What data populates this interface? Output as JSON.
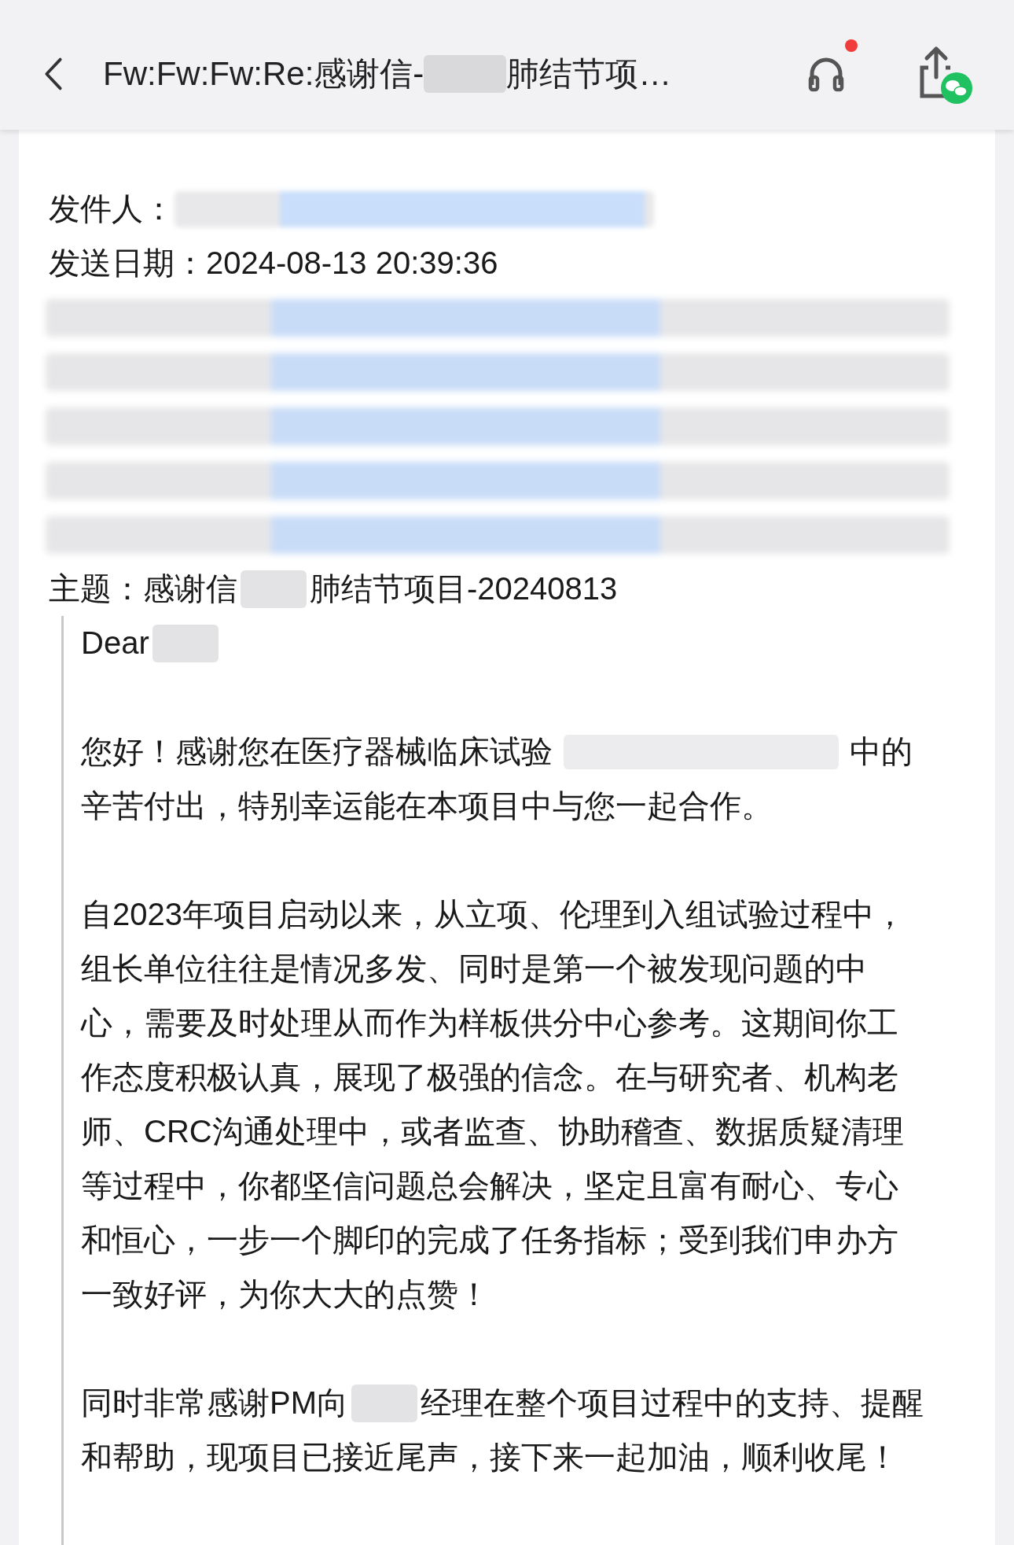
{
  "header": {
    "title_start": "Fw:Fw:Fw:Re:感谢信-",
    "title_end": "肺结节项…",
    "notification_dot": true
  },
  "meta": [
    {
      "kind": "sender",
      "label": "发件人："
    },
    {
      "kind": "field",
      "label": "发送日期：",
      "value": "2024-08-13 20:39:36"
    },
    {
      "kind": "hidden"
    },
    {
      "kind": "hidden"
    },
    {
      "kind": "hidden"
    },
    {
      "kind": "hidden"
    },
    {
      "kind": "hidden"
    }
  ],
  "subject": {
    "label": "主题：",
    "segments": [
      {
        "kind": "text",
        "text": "感谢信"
      },
      {
        "kind": "redacted"
      },
      {
        "kind": "text",
        "text": "肺结节项目-20240813"
      }
    ]
  },
  "body": [
    [
      [
        {
          "kind": "text",
          "text": "Dear"
        },
        {
          "kind": "redacted"
        }
      ]
    ],
    [
      [
        {
          "kind": "text",
          "text": "您好！感谢您在医疗器械临床试验"
        },
        {
          "kind": "redacted_long"
        },
        {
          "kind": "text",
          "text": "中的"
        }
      ],
      [
        {
          "kind": "text",
          "text": "辛苦付出，特别幸运能在本项目中与您一起合作。"
        }
      ]
    ],
    [
      [
        {
          "kind": "text",
          "text": "自2023年项目启动以来，从立项、伦理到入组试验过程中，"
        }
      ],
      [
        {
          "kind": "text",
          "text": "组长单位往往是情况多发、同时是第一个被发现问题的中"
        }
      ],
      [
        {
          "kind": "text",
          "text": "心，需要及时处理从而作为样板供分中心参考。这期间你工"
        }
      ],
      [
        {
          "kind": "text",
          "text": "作态度积极认真，展现了极强的信念。在与研究者、机构老"
        }
      ],
      [
        {
          "kind": "text",
          "text": "师、CRC沟通处理中，或者监查、协助稽查、数据质疑清理"
        }
      ],
      [
        {
          "kind": "text",
          "text": "等过程中，你都坚信问题总会解决，坚定且富有耐心、专心"
        }
      ],
      [
        {
          "kind": "text",
          "text": "和恒心，一步一个脚印的完成了任务指标；受到我们申办方"
        }
      ],
      [
        {
          "kind": "text",
          "text": "一致好评，为你大大的点赞！"
        }
      ]
    ],
    [
      [
        {
          "kind": "text",
          "text": "同时非常感谢PM向"
        },
        {
          "kind": "redacted"
        },
        {
          "kind": "text",
          "text": "经理在整个项目过程中的支持、提醒"
        }
      ],
      [
        {
          "kind": "text",
          "text": "和帮助，现项目已接近尾声，接下来一起加油，顺利收尾！"
        }
      ]
    ]
  ]
}
